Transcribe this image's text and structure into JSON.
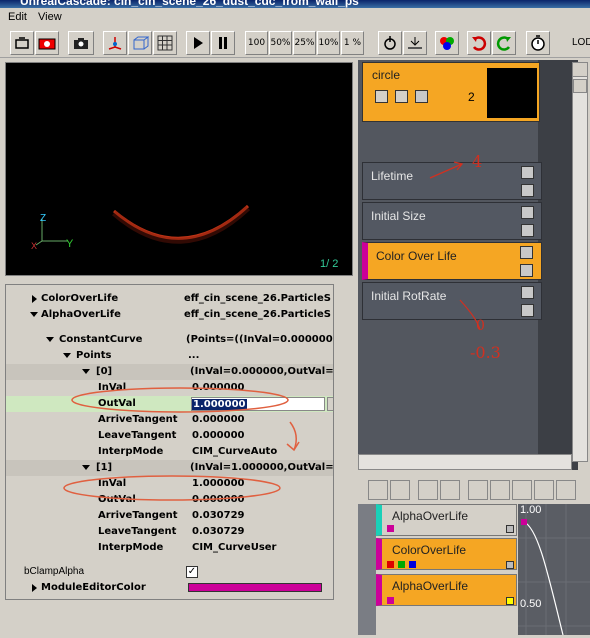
{
  "window": {
    "title": "UnrealCascade: cin_cin_scene_26_dust_cdc_from_wall_ps"
  },
  "menu": {
    "edit": "Edit",
    "view": "View"
  },
  "toolbar": {
    "speed_100": "100",
    "speed_50": "50%",
    "speed_25": "25%",
    "speed_10": "10%",
    "speed_1": "1 %",
    "lod": "LOD"
  },
  "viewport": {
    "axis_z": "Z",
    "axis_y": "Y",
    "axis_x": "X",
    "counter": "1/ 2"
  },
  "emitter": {
    "name": "circle",
    "count": "2"
  },
  "modules": [
    {
      "label": "Lifetime"
    },
    {
      "label": "Initial Size"
    },
    {
      "label": "Color Over Life"
    },
    {
      "label": "Initial RotRate"
    }
  ],
  "props": {
    "rows": [
      {
        "name": "ColorOverLife",
        "value": "eff_cin_scene_26.ParticleS"
      },
      {
        "name": "AlphaOverLife",
        "value": "eff_cin_scene_26.ParticleS"
      },
      {
        "name": "ConstantCurve",
        "value": "(Points=((InVal=0.000000"
      },
      {
        "name": "Points",
        "value": "..."
      },
      {
        "name": "[0]",
        "value": "(InVal=0.000000,OutVal="
      },
      {
        "name": "InVal",
        "value": "0.000000"
      },
      {
        "name": "OutVal",
        "value": "1.000000"
      },
      {
        "name": "ArriveTangent",
        "value": "0.000000"
      },
      {
        "name": "LeaveTangent",
        "value": "0.000000"
      },
      {
        "name": "InterpMode",
        "value": "CIM_CurveAuto"
      },
      {
        "name": "[1]",
        "value": "(InVal=1.000000,OutVal="
      },
      {
        "name": "InVal",
        "value": "1.000000"
      },
      {
        "name": "OutVal",
        "value": "0.000000"
      },
      {
        "name": "ArriveTangent",
        "value": "0.030729"
      },
      {
        "name": "LeaveTangent",
        "value": "0.030729"
      },
      {
        "name": "InterpMode",
        "value": "CIM_CurveUser"
      },
      {
        "name": "bClampAlpha",
        "value": ""
      },
      {
        "name": "ModuleEditorColor",
        "value": ""
      }
    ]
  },
  "annotations": {
    "a1": "4",
    "a2": "0",
    "a3": "-0.3"
  },
  "curve_editor": {
    "modules": [
      {
        "label": "AlphaOverLife"
      },
      {
        "label": "ColorOverLife"
      },
      {
        "label": "AlphaOverLife"
      }
    ],
    "y_top": "1.00",
    "y_mid": "0.50"
  },
  "colors": {
    "orange": "#f5a623",
    "magenta": "#cc0099",
    "panel": "#53575f"
  }
}
